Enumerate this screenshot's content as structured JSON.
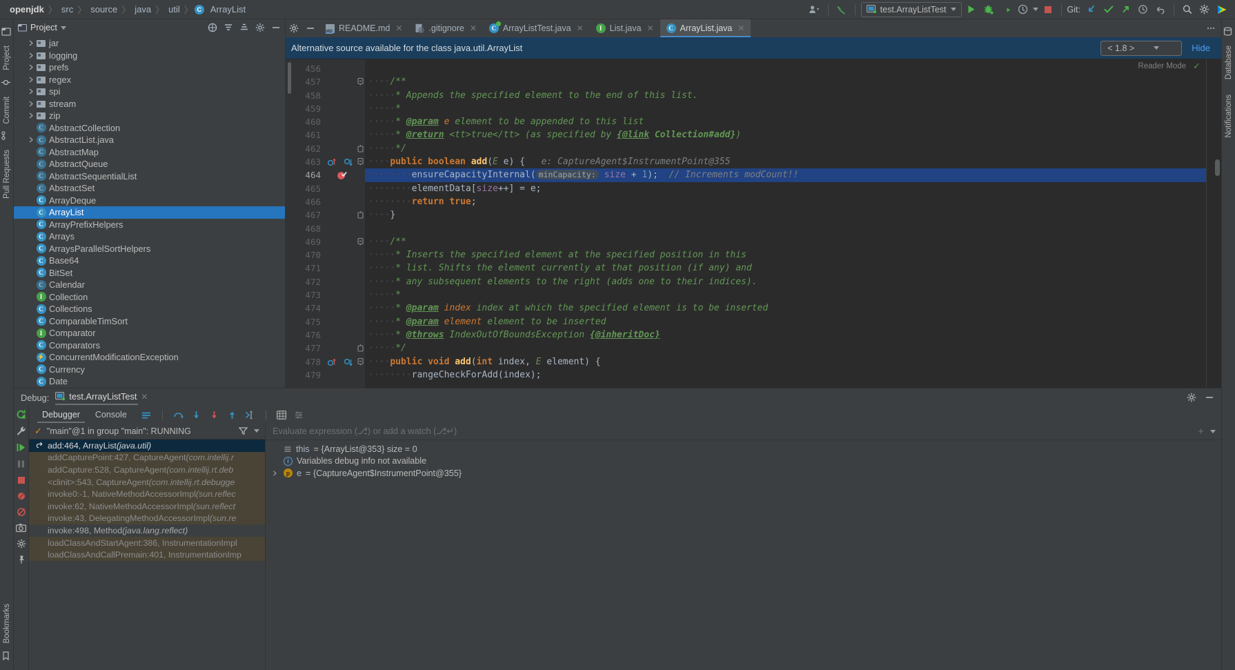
{
  "breadcrumb": {
    "items": [
      "openjdk",
      "src",
      "source",
      "java",
      "util"
    ],
    "final": "ArrayList",
    "separator": "〉"
  },
  "topbar": {
    "run_config": "test.ArrayListTest",
    "git_label": "Git:",
    "icons": [
      "user-avatar-icon",
      "build-hammer-icon",
      "run-icon",
      "debug-icon",
      "coverage-icon",
      "profile-icon",
      "stop-icon",
      "git-update-icon",
      "git-commit-icon",
      "git-push-icon",
      "history-icon",
      "rollback-icon",
      "search-everywhere-icon",
      "settings-gear-icon",
      "intellij-logo-icon"
    ]
  },
  "left_rail": {
    "project_label": "Project",
    "commit_label": "Commit",
    "pull_requests_label": "Pull Requests",
    "bookmarks_label": "Bookmarks"
  },
  "right_rail": {
    "database_label": "Database",
    "notifications_label": "Notifications"
  },
  "project_panel": {
    "title": "Project",
    "tree": [
      {
        "label": "jar",
        "type": "folder",
        "arrow": true,
        "indent": 1,
        "selected": false
      },
      {
        "label": "logging",
        "type": "folder",
        "arrow": true,
        "indent": 1,
        "selected": false
      },
      {
        "label": "prefs",
        "type": "folder",
        "arrow": true,
        "indent": 1,
        "selected": false
      },
      {
        "label": "regex",
        "type": "folder",
        "arrow": true,
        "indent": 1,
        "selected": false
      },
      {
        "label": "spi",
        "type": "folder",
        "arrow": true,
        "indent": 1,
        "selected": false
      },
      {
        "label": "stream",
        "type": "folder",
        "arrow": true,
        "indent": 1,
        "selected": false
      },
      {
        "label": "zip",
        "type": "folder",
        "arrow": true,
        "indent": 1,
        "selected": false
      },
      {
        "label": "AbstractCollection",
        "type": "abstract-class",
        "arrow": false,
        "indent": 1,
        "selected": false
      },
      {
        "label": "AbstractList.java",
        "type": "abstract-class",
        "arrow": true,
        "indent": 1,
        "selected": false
      },
      {
        "label": "AbstractMap",
        "type": "abstract-class",
        "arrow": false,
        "indent": 1,
        "selected": false
      },
      {
        "label": "AbstractQueue",
        "type": "abstract-class",
        "arrow": false,
        "indent": 1,
        "selected": false
      },
      {
        "label": "AbstractSequentialList",
        "type": "abstract-class",
        "arrow": false,
        "indent": 1,
        "selected": false
      },
      {
        "label": "AbstractSet",
        "type": "abstract-class",
        "arrow": false,
        "indent": 1,
        "selected": false
      },
      {
        "label": "ArrayDeque",
        "type": "class",
        "arrow": false,
        "indent": 1,
        "selected": false
      },
      {
        "label": "ArrayList",
        "type": "class",
        "arrow": false,
        "indent": 1,
        "selected": true
      },
      {
        "label": "ArrayPrefixHelpers",
        "type": "class",
        "arrow": false,
        "indent": 1,
        "selected": false
      },
      {
        "label": "Arrays",
        "type": "class",
        "arrow": false,
        "indent": 1,
        "selected": false
      },
      {
        "label": "ArraysParallelSortHelpers",
        "type": "class",
        "arrow": false,
        "indent": 1,
        "selected": false
      },
      {
        "label": "Base64",
        "type": "class",
        "arrow": false,
        "indent": 1,
        "selected": false
      },
      {
        "label": "BitSet",
        "type": "class",
        "arrow": false,
        "indent": 1,
        "selected": false
      },
      {
        "label": "Calendar",
        "type": "abstract-class",
        "arrow": false,
        "indent": 1,
        "selected": false
      },
      {
        "label": "Collection",
        "type": "interface",
        "arrow": false,
        "indent": 1,
        "selected": false
      },
      {
        "label": "Collections",
        "type": "class",
        "arrow": false,
        "indent": 1,
        "selected": false
      },
      {
        "label": "ComparableTimSort",
        "type": "class",
        "arrow": false,
        "indent": 1,
        "selected": false
      },
      {
        "label": "Comparator",
        "type": "interface",
        "arrow": false,
        "indent": 1,
        "selected": false
      },
      {
        "label": "Comparators",
        "type": "class",
        "arrow": false,
        "indent": 1,
        "selected": false
      },
      {
        "label": "ConcurrentModificationException",
        "type": "exception",
        "arrow": false,
        "indent": 1,
        "selected": false
      },
      {
        "label": "Currency",
        "type": "class",
        "arrow": false,
        "indent": 1,
        "selected": false
      },
      {
        "label": "Date",
        "type": "class",
        "arrow": false,
        "indent": 1,
        "selected": false
      }
    ]
  },
  "editor": {
    "tabs": [
      {
        "label": "README.md",
        "icon": "markdown-icon",
        "active": false
      },
      {
        "label": ".gitignore",
        "icon": "gitignore-icon",
        "active": false
      },
      {
        "label": "ArrayListTest.java",
        "icon": "test-class-icon",
        "active": false
      },
      {
        "label": "List.java",
        "icon": "interface-icon",
        "active": false
      },
      {
        "label": "ArrayList.java",
        "icon": "class-icon",
        "active": true
      }
    ],
    "notification": {
      "text": "Alternative source available for the class java.util.ArrayList",
      "version_value": "< 1.8 >",
      "hide_label": "Hide"
    },
    "reader_mode_label": "Reader Mode",
    "line_numbers": [
      "456",
      "457",
      "458",
      "459",
      "460",
      "461",
      "462",
      "463",
      "464",
      "465",
      "466",
      "467",
      "468",
      "469",
      "470",
      "471",
      "472",
      "473",
      "474",
      "475",
      "476",
      "477",
      "478",
      "479"
    ],
    "current_line": "464",
    "code_lines": [
      {
        "n": "456",
        "segments": []
      },
      {
        "n": "457",
        "fold": "open",
        "segments": [
          {
            "t": "····",
            "c": "dots"
          },
          {
            "t": "/**",
            "c": "cmt"
          }
        ]
      },
      {
        "n": "458",
        "segments": [
          {
            "t": "·····",
            "c": "dots"
          },
          {
            "t": "* Appends the specified element to the end of this list.",
            "c": "cmt"
          }
        ]
      },
      {
        "n": "459",
        "segments": [
          {
            "t": "·····",
            "c": "dots"
          },
          {
            "t": "*",
            "c": "cmt"
          }
        ]
      },
      {
        "n": "460",
        "segments": [
          {
            "t": "·····",
            "c": "dots"
          },
          {
            "t": "* ",
            "c": "cmt"
          },
          {
            "t": "@param",
            "c": "cmt-tag"
          },
          {
            "t": " e",
            "c": "param-name"
          },
          {
            "t": " element to be appended to this list",
            "c": "cmt"
          }
        ]
      },
      {
        "n": "461",
        "segments": [
          {
            "t": "·····",
            "c": "dots"
          },
          {
            "t": "* ",
            "c": "cmt"
          },
          {
            "t": "@return",
            "c": "cmt-tag"
          },
          {
            "t": " <tt>true</tt> (as specified by ",
            "c": "cmt"
          },
          {
            "t": "{@link",
            "c": "cmt-tag"
          },
          {
            "t": " Collection#add}",
            "c": "cmt-bold"
          },
          {
            "t": ")",
            "c": "cmt"
          }
        ]
      },
      {
        "n": "462",
        "fold": "close",
        "segments": [
          {
            "t": "·····",
            "c": "dots"
          },
          {
            "t": "*/",
            "c": "cmt"
          }
        ]
      },
      {
        "n": "463",
        "fold": "open",
        "gutter": [
          "override-icon",
          "implemented-icon"
        ],
        "segments": [
          {
            "t": "····",
            "c": "dots"
          },
          {
            "t": "public boolean ",
            "c": "kw"
          },
          {
            "t": "add",
            "c": "mname"
          },
          {
            "t": "(",
            "c": "ident"
          },
          {
            "t": "E",
            "c": "typ-green"
          },
          {
            "t": " e) {",
            "c": "ident"
          },
          {
            "t": "   e: CaptureAgent$InstrumentPoint@355",
            "c": "hint"
          }
        ]
      },
      {
        "n": "464",
        "highlight": true,
        "gutter": [
          "breakpoint-verified-icon"
        ],
        "segments": [
          {
            "t": "····",
            "c": "dots"
          },
          {
            "t": "····",
            "c": "dots"
          },
          {
            "t": "ensureCapacityInternal(",
            "c": "ident"
          },
          {
            "t": "minCapacity:",
            "c": "phint"
          },
          {
            "t": " ",
            "c": "ident"
          },
          {
            "t": "size",
            "c": "fld"
          },
          {
            "t": " + ",
            "c": "ident"
          },
          {
            "t": "1",
            "c": "num"
          },
          {
            "t": ");",
            "c": "ident"
          },
          {
            "t": "  // Increments modCount!!",
            "c": "linecmt"
          }
        ]
      },
      {
        "n": "465",
        "segments": [
          {
            "t": "········",
            "c": "dots"
          },
          {
            "t": "elementData[",
            "c": "ident"
          },
          {
            "t": "size",
            "c": "fld"
          },
          {
            "t": "++] = e;",
            "c": "ident"
          }
        ]
      },
      {
        "n": "466",
        "segments": [
          {
            "t": "········",
            "c": "dots"
          },
          {
            "t": "return true",
            "c": "kw"
          },
          {
            "t": ";",
            "c": "ident"
          }
        ]
      },
      {
        "n": "467",
        "fold": "close",
        "segments": [
          {
            "t": "····",
            "c": "dots"
          },
          {
            "t": "}",
            "c": "ident"
          }
        ]
      },
      {
        "n": "468",
        "segments": []
      },
      {
        "n": "469",
        "fold": "open",
        "segments": [
          {
            "t": "····",
            "c": "dots"
          },
          {
            "t": "/**",
            "c": "cmt"
          }
        ]
      },
      {
        "n": "470",
        "segments": [
          {
            "t": "·····",
            "c": "dots"
          },
          {
            "t": "* Inserts the specified element at the specified position in this",
            "c": "cmt"
          }
        ]
      },
      {
        "n": "471",
        "segments": [
          {
            "t": "·····",
            "c": "dots"
          },
          {
            "t": "* list. Shifts the element currently at that position (if any) and",
            "c": "cmt"
          }
        ]
      },
      {
        "n": "472",
        "segments": [
          {
            "t": "·····",
            "c": "dots"
          },
          {
            "t": "* any subsequent elements to the right (adds one to their indices).",
            "c": "cmt"
          }
        ]
      },
      {
        "n": "473",
        "segments": [
          {
            "t": "·····",
            "c": "dots"
          },
          {
            "t": "*",
            "c": "cmt"
          }
        ]
      },
      {
        "n": "474",
        "segments": [
          {
            "t": "·····",
            "c": "dots"
          },
          {
            "t": "* ",
            "c": "cmt"
          },
          {
            "t": "@param",
            "c": "cmt-tag"
          },
          {
            "t": " index",
            "c": "param-name"
          },
          {
            "t": " index at which the specified element is to be inserted",
            "c": "cmt"
          }
        ]
      },
      {
        "n": "475",
        "segments": [
          {
            "t": "·····",
            "c": "dots"
          },
          {
            "t": "* ",
            "c": "cmt"
          },
          {
            "t": "@param",
            "c": "cmt-tag"
          },
          {
            "t": " element",
            "c": "param-name"
          },
          {
            "t": " element to be inserted",
            "c": "cmt"
          }
        ]
      },
      {
        "n": "476",
        "segments": [
          {
            "t": "·····",
            "c": "dots"
          },
          {
            "t": "* ",
            "c": "cmt"
          },
          {
            "t": "@throws",
            "c": "cmt-tag"
          },
          {
            "t": " IndexOutOfBoundsException ",
            "c": "cmt"
          },
          {
            "t": "{@inheritDoc}",
            "c": "cmt-tag"
          }
        ]
      },
      {
        "n": "477",
        "fold": "close",
        "segments": [
          {
            "t": "·····",
            "c": "dots"
          },
          {
            "t": "*/",
            "c": "cmt"
          }
        ]
      },
      {
        "n": "478",
        "fold": "open",
        "gutter": [
          "override-icon",
          "implemented-icon"
        ],
        "segments": [
          {
            "t": "····",
            "c": "dots"
          },
          {
            "t": "public void ",
            "c": "kw"
          },
          {
            "t": "add",
            "c": "mname"
          },
          {
            "t": "(",
            "c": "ident"
          },
          {
            "t": "int",
            "c": "kw"
          },
          {
            "t": " index, ",
            "c": "ident"
          },
          {
            "t": "E",
            "c": "typ-green"
          },
          {
            "t": " element) {",
            "c": "ident"
          }
        ]
      },
      {
        "n": "479",
        "segments": [
          {
            "t": "········",
            "c": "dots"
          },
          {
            "t": "rangeCheckForAdd(index);",
            "c": "ident"
          }
        ]
      }
    ]
  },
  "debug": {
    "header_label": "Debug:",
    "session_tab": "test.ArrayListTest",
    "tabs": [
      {
        "label": "Debugger",
        "active": true
      },
      {
        "label": "Console",
        "active": false
      }
    ],
    "toolbar_icons": [
      "show-execution-point-icon",
      "step-over-icon",
      "step-into-icon",
      "force-step-into-icon",
      "step-out-icon",
      "run-to-cursor-icon",
      "evaluate-expression-icon",
      "settings-icon"
    ],
    "rail_icons": [
      "rerun-icon",
      "settings-wrench-icon",
      "resume-icon",
      "pause-icon",
      "stop-icon",
      "mute-breakpoints-icon",
      "view-breakpoints-icon",
      "camera-icon",
      "settings-gear-icon",
      "pin-icon"
    ],
    "thread_status": "\"main\"@1 in group \"main\": RUNNING",
    "frames": [
      {
        "label": "add:464, ArrayList",
        "pkg": "(java.util)",
        "style": "selected"
      },
      {
        "label": "addCapturePoint:427, CaptureAgent",
        "pkg": "(com.intellij.r",
        "style": "library"
      },
      {
        "label": "addCapture:528, CaptureAgent",
        "pkg": "(com.intellij.rt.deb",
        "style": "library"
      },
      {
        "label": "<clinit>:543, CaptureAgent",
        "pkg": "(com.intellij.rt.debugge",
        "style": "library"
      },
      {
        "label": "invoke0:-1, NativeMethodAccessorImpl",
        "pkg": "(sun.reflec",
        "style": "library"
      },
      {
        "label": "invoke:62, NativeMethodAccessorImpl",
        "pkg": "(sun.reflect",
        "style": "library"
      },
      {
        "label": "invoke:43, DelegatingMethodAccessorImpl",
        "pkg": "(sun.re",
        "style": "library"
      },
      {
        "label": "invoke:498, Method",
        "pkg": "(java.lang.reflect)",
        "style": "normal"
      },
      {
        "label": "loadClassAndStartAgent:386, InstrumentationImpl",
        "pkg": "",
        "style": "library"
      },
      {
        "label": "loadClassAndCallPremain:401, InstrumentationImp",
        "pkg": "",
        "style": "library"
      }
    ],
    "eval_placeholder": "Evaluate expression (⎇) or add a watch (⎇↵)",
    "variables": [
      {
        "icon": "field-icon",
        "name": "this",
        "value": " = {ArrayList@353}  size = 0",
        "expandable": false
      },
      {
        "icon": "info-icon",
        "name": "Variables debug info not available",
        "value": "",
        "expandable": false
      },
      {
        "icon": "param-icon",
        "name": "e",
        "value": " = {CaptureAgent$InstrumentPoint@355}",
        "expandable": true
      }
    ]
  },
  "colors": {
    "accent_blue": "#2675bf",
    "selection": "#214283",
    "keyword": "#cc7832",
    "comment": "#629755",
    "method": "#ffc66d",
    "field": "#9876aa",
    "number": "#6897bb",
    "notification_bg": "#1b3e5c",
    "link": "#4d9ff5"
  }
}
